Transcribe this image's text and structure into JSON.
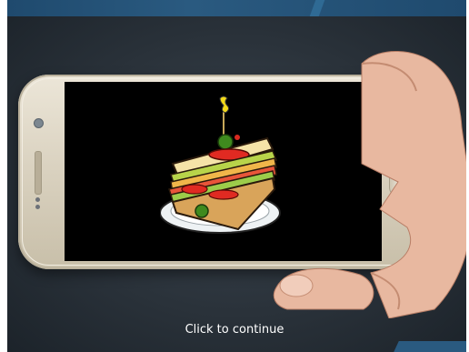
{
  "prompt": {
    "continue_text": "Click to continue"
  },
  "colors": {
    "background": "#2a323a",
    "phone_body": "#e3dccd",
    "screen": "#000000",
    "accent_bar": "#2a5a80"
  },
  "icons": {
    "illustration": "sandwich-illustration"
  }
}
